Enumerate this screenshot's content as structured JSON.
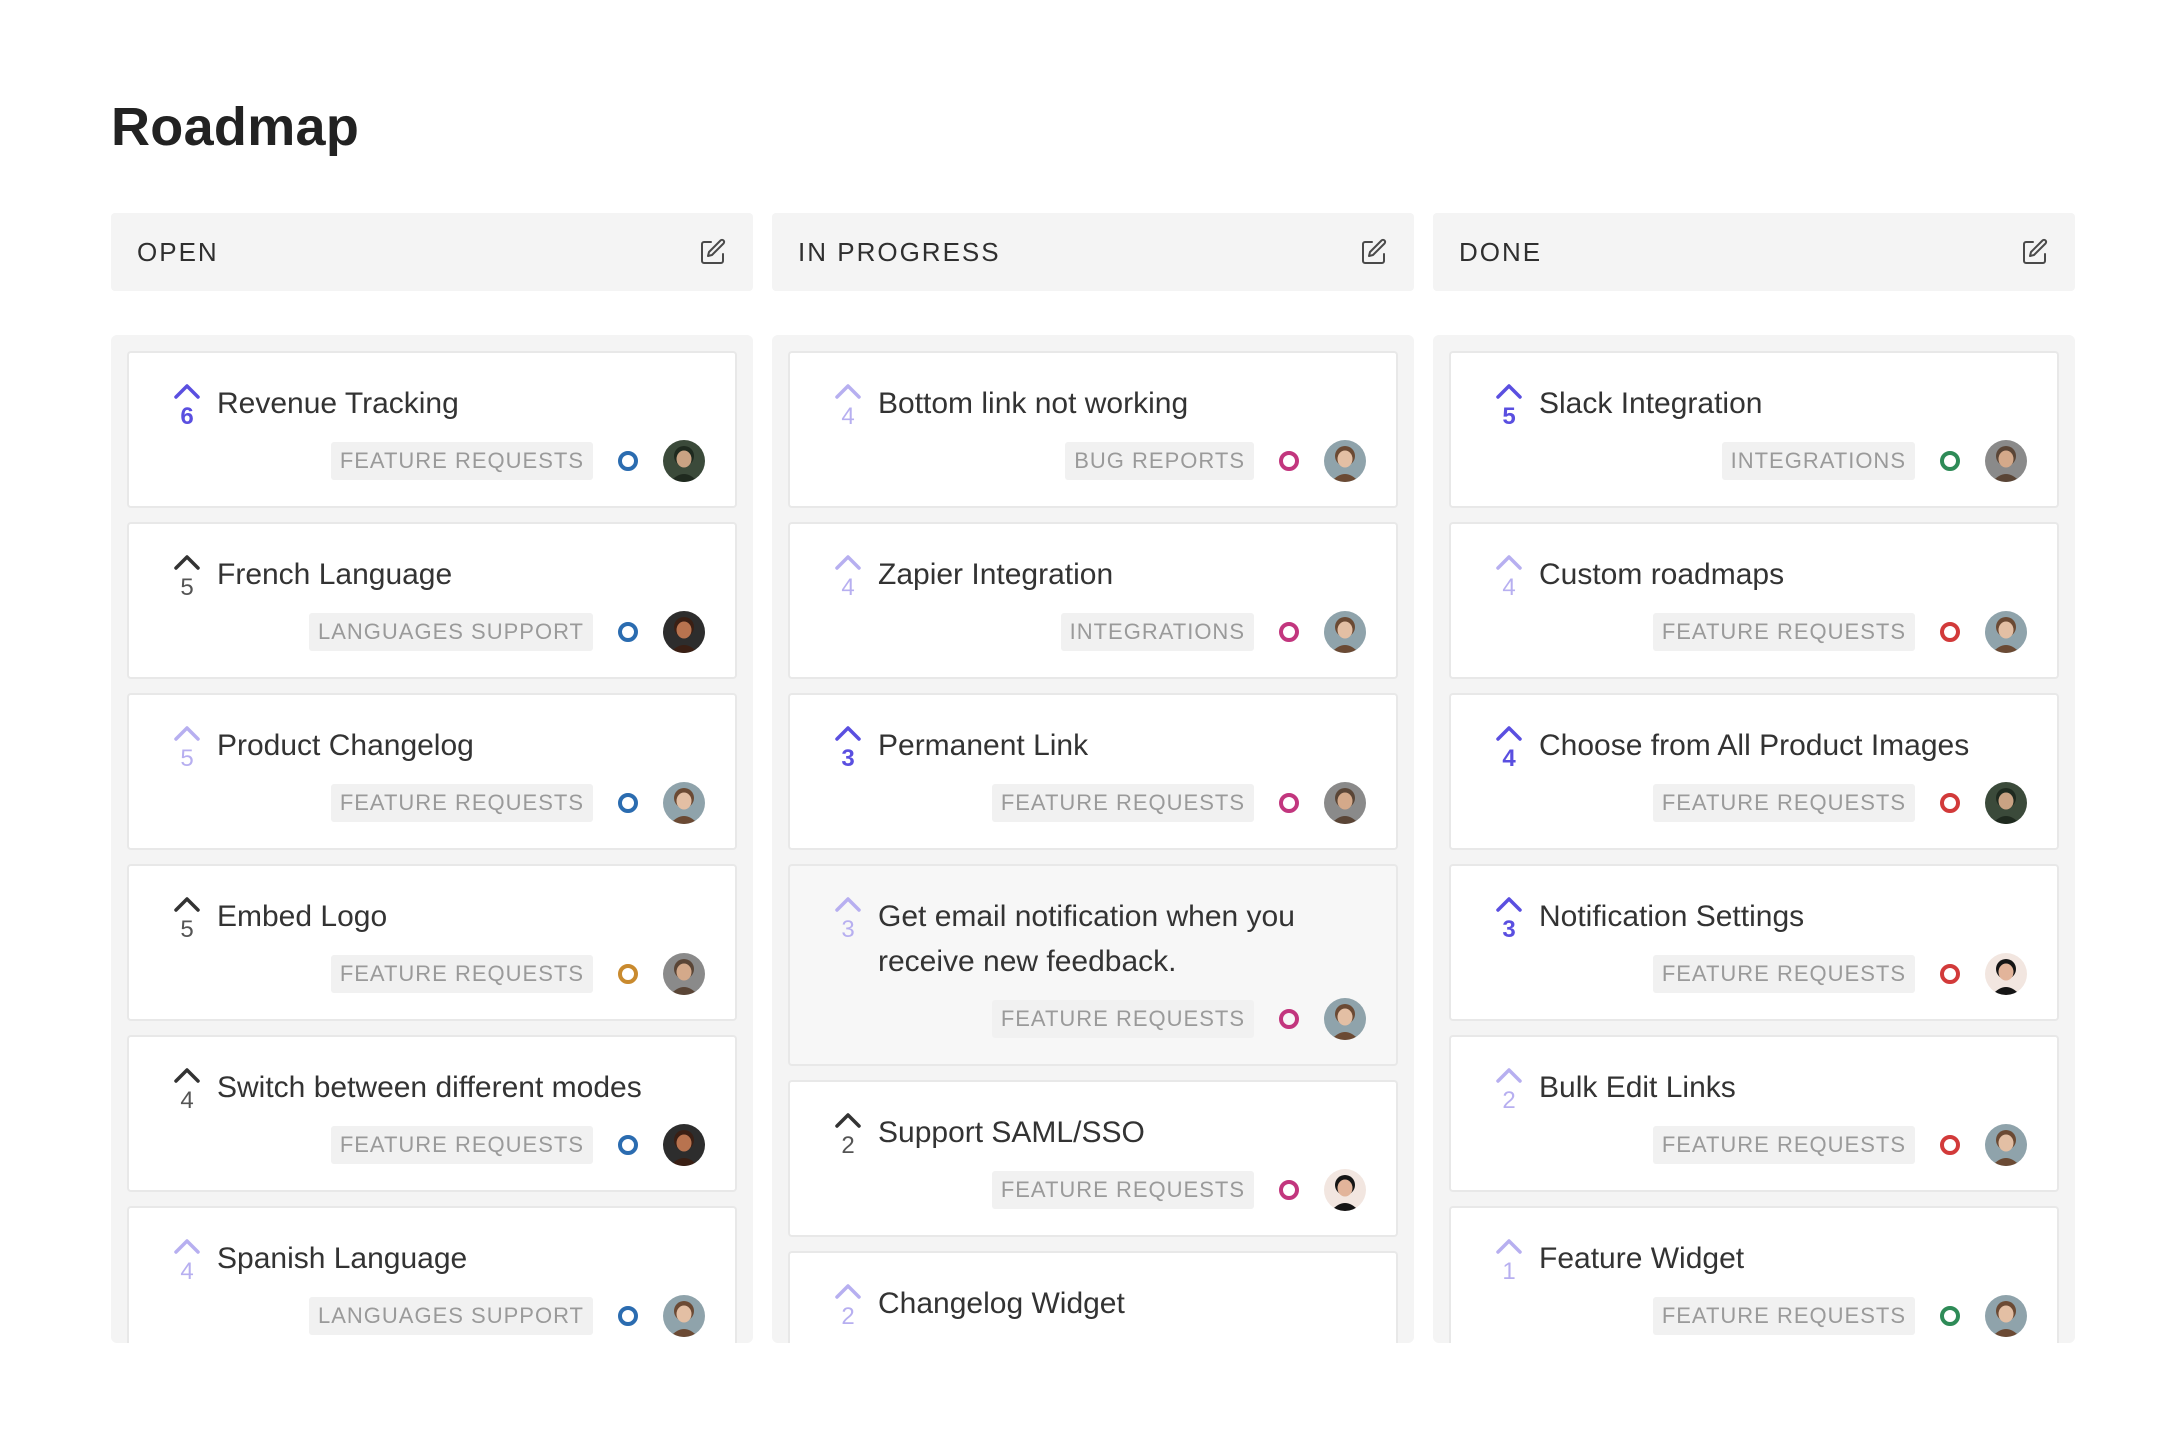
{
  "page": {
    "title": "Roadmap"
  },
  "colors": {
    "strong_vote": "#5a4fe0",
    "light_vote": "#b7aff0",
    "status_blue": "#2b6cb0",
    "status_orange": "#c98a2e",
    "status_magenta": "#c2367e",
    "status_red": "#d23a3a",
    "status_green": "#2e8b57"
  },
  "columns": [
    {
      "title": "OPEN",
      "cards": [
        {
          "title": "Revenue Tracking",
          "votes": "6",
          "tag": "FEATURE REQUESTS",
          "vote_style": "strong",
          "status_color": "#2b6cb0",
          "avatar": "avatar-dark-green"
        },
        {
          "title": "French Language",
          "votes": "5",
          "tag": "LANGUAGES SUPPORT",
          "vote_style": "dark",
          "status_color": "#2b6cb0",
          "avatar": "avatar-beard"
        },
        {
          "title": "Product Changelog",
          "votes": "5",
          "tag": "FEATURE REQUESTS",
          "vote_style": "light",
          "status_color": "#2b6cb0",
          "avatar": "avatar-woman"
        },
        {
          "title": "Embed Logo",
          "votes": "5",
          "tag": "FEATURE REQUESTS",
          "vote_style": "dark",
          "status_color": "#c98a2e",
          "avatar": "avatar-man"
        },
        {
          "title": "Switch between different modes",
          "votes": "4",
          "tag": "FEATURE REQUESTS",
          "vote_style": "dark",
          "status_color": "#2b6cb0",
          "avatar": "avatar-beard"
        },
        {
          "title": "Spanish Language",
          "votes": "4",
          "tag": "LANGUAGES SUPPORT",
          "vote_style": "light",
          "status_color": "#2b6cb0",
          "avatar": "avatar-woman"
        }
      ]
    },
    {
      "title": "IN PROGRESS",
      "cards": [
        {
          "title": "Bottom link not working",
          "votes": "4",
          "tag": "BUG REPORTS",
          "vote_style": "light",
          "status_color": "#c2367e",
          "avatar": "avatar-woman"
        },
        {
          "title": "Zapier Integration",
          "votes": "4",
          "tag": "INTEGRATIONS",
          "vote_style": "light",
          "status_color": "#c2367e",
          "avatar": "avatar-woman"
        },
        {
          "title": "Permanent Link",
          "votes": "3",
          "tag": "FEATURE REQUESTS",
          "vote_style": "strong",
          "status_color": "#c2367e",
          "avatar": "avatar-man"
        },
        {
          "title": "Get email notification when you receive new feedback.",
          "votes": "3",
          "tag": "FEATURE REQUESTS",
          "vote_style": "light",
          "status_color": "#c2367e",
          "avatar": "avatar-woman",
          "tall": true
        },
        {
          "title": "Support SAML/SSO",
          "votes": "2",
          "tag": "FEATURE REQUESTS",
          "vote_style": "dark",
          "status_color": "#c2367e",
          "avatar": "avatar-dark-hair"
        },
        {
          "title": "Changelog Widget",
          "votes": "2",
          "tag": "",
          "vote_style": "light",
          "status_color": "#c2367e",
          "avatar": ""
        }
      ]
    },
    {
      "title": "DONE",
      "cards": [
        {
          "title": "Slack Integration",
          "votes": "5",
          "tag": "INTEGRATIONS",
          "vote_style": "strong",
          "status_color": "#2e8b57",
          "avatar": "avatar-man"
        },
        {
          "title": "Custom roadmaps",
          "votes": "4",
          "tag": "FEATURE REQUESTS",
          "vote_style": "light",
          "status_color": "#d23a3a",
          "avatar": "avatar-woman"
        },
        {
          "title": "Choose from All Product Images",
          "votes": "4",
          "tag": "FEATURE REQUESTS",
          "vote_style": "strong",
          "status_color": "#d23a3a",
          "avatar": "avatar-dark-green"
        },
        {
          "title": "Notification Settings",
          "votes": "3",
          "tag": "FEATURE REQUESTS",
          "vote_style": "strong",
          "status_color": "#d23a3a",
          "avatar": "avatar-dark-hair"
        },
        {
          "title": "Bulk Edit Links",
          "votes": "2",
          "tag": "FEATURE REQUESTS",
          "vote_style": "light",
          "status_color": "#d23a3a",
          "avatar": "avatar-woman"
        },
        {
          "title": "Feature Widget",
          "votes": "1",
          "tag": "FEATURE REQUESTS",
          "vote_style": "light",
          "status_color": "#2e8b57",
          "avatar": "avatar-woman"
        }
      ]
    }
  ]
}
